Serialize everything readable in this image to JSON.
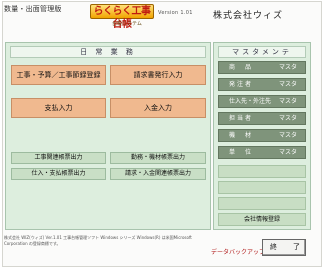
{
  "header": {
    "subsystem": "数量・出面管理版",
    "logo_text": "らくらく工事台帳",
    "logo_subtitle": "台帳システム",
    "version": "Version 1.01",
    "company": "株式会社ウィズ"
  },
  "daily": {
    "title": "日 常 業 務",
    "buttons": [
      "工事・予算／工事節録登録",
      "請求書発行入力",
      "支払入力",
      "入金入力"
    ],
    "reports": [
      "工事関連帳票出力",
      "勤務・機材帳票出力",
      "仕入・支払帳票出力",
      "請求・入金関連帳票出力"
    ]
  },
  "master": {
    "title": "マスタメンテ",
    "suffix": "マスタ",
    "items": [
      "商　品",
      "発注者",
      "仕入先・外注先",
      "担当者",
      "機　材",
      "単　位"
    ],
    "company_info": "会社情報登録"
  },
  "footer": {
    "text": "株式会社 WIZ(ウィズ) Ver.1.01 工事台帳管理ソフト Windows シリーズ Windows(R) は米国Microsoft Corporation の登録商標です。"
  },
  "actions": {
    "backup": "データバックアップ",
    "exit_left": "終",
    "exit_right": "了"
  },
  "colors": {
    "orange_button": "#f0b98f",
    "green_panel": "#ddeede",
    "master_button": "#7f947b",
    "logo_red": "#c01b10"
  }
}
